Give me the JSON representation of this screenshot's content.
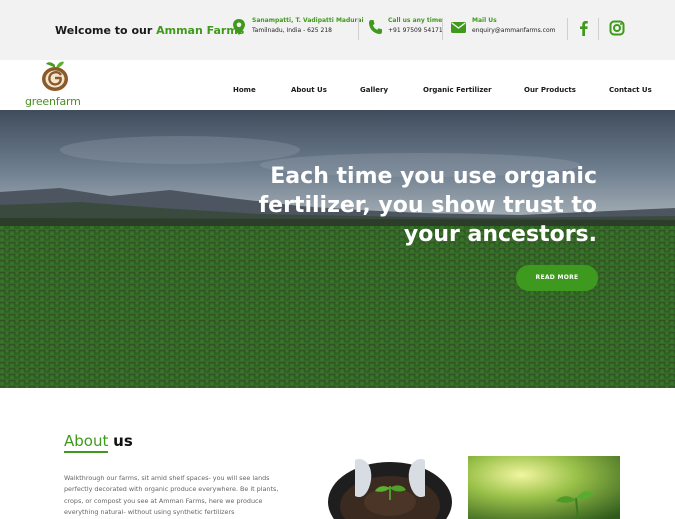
{
  "topbar": {
    "welcome_prefix": "Welcome to our",
    "welcome_brand": "Amman Farms",
    "address": {
      "line1": "Sanampatti, T. Vadipatti Madurai",
      "line2": "Tamilnadu, India - 625 218"
    },
    "phone": {
      "label": "Call us any time",
      "value": "+91 97509 54171"
    },
    "mail": {
      "label": "Mail Us",
      "value": "enquiry@ammanfarms.com"
    },
    "social": [
      "facebook-icon",
      "instagram-icon"
    ]
  },
  "logo": {
    "text": "greenfarm"
  },
  "nav": {
    "items": [
      "Home",
      "About Us",
      "Gallery",
      "Organic Fertilizer",
      "Our Products",
      "Contact Us"
    ]
  },
  "hero": {
    "title": "Each time you use organic fertilizer, you show trust to your ancestors.",
    "button": "READ MORE"
  },
  "about": {
    "title_part1": "About",
    "title_part2": "us",
    "text": "Walkthrough our farms, sit amid shelf spaces- you will see lands perfectly decorated with organic produce everywhere. Be it plants, crops, or compost you see at Amman Farms, here we produce everything natural- without using synthetic fertilizers"
  },
  "colors": {
    "accent": "#3f9a1b",
    "topbar_bg": "#f2f2f2",
    "button": "#3e9a1e"
  }
}
